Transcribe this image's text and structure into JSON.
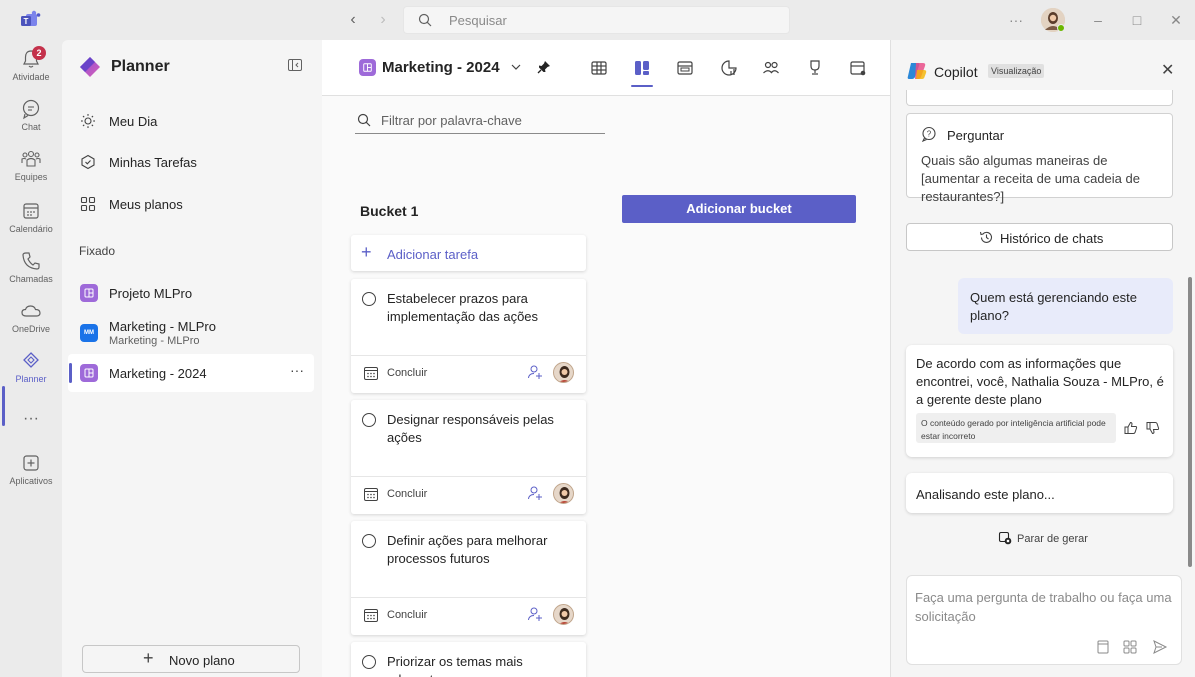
{
  "titlebar": {
    "search_placeholder": "Pesquisar",
    "more_label": "···"
  },
  "rail": {
    "badge_count": "2",
    "items": [
      {
        "label": "Atividade",
        "icon": "bell-icon"
      },
      {
        "label": "Chat",
        "icon": "chat-icon"
      },
      {
        "label": "Equipes",
        "icon": "teams-icon"
      },
      {
        "label": "Calendário",
        "icon": "calendar-icon"
      },
      {
        "label": "Chamadas",
        "icon": "phone-icon"
      },
      {
        "label": "OneDrive",
        "icon": "cloud-icon"
      },
      {
        "label": "Planner",
        "icon": "planner-icon"
      },
      {
        "label": "···",
        "icon": "more-icon"
      },
      {
        "label": "Aplicativos",
        "icon": "add-apps-icon"
      }
    ]
  },
  "left_panel": {
    "title": "Planner",
    "nav": [
      {
        "label": "Meu Dia",
        "icon": "sun-icon"
      },
      {
        "label": "Minhas Tarefas",
        "icon": "tasks-icon"
      },
      {
        "label": "Meus planos",
        "icon": "grid-icon"
      }
    ],
    "pinned_label": "Fixado",
    "plans": [
      {
        "name": "Projeto MLPro",
        "subtitle": ""
      },
      {
        "name": "Marketing - MLPro",
        "subtitle": "Marketing - MLPro",
        "icon_text": "MM"
      },
      {
        "name": "Marketing - 2024",
        "subtitle": "",
        "more": "···"
      }
    ],
    "new_plan_label": "Novo plano"
  },
  "main": {
    "plan_title": "Marketing - 2024",
    "filter_placeholder": "Filtrar por palavra-chave",
    "bucket_title": "Bucket 1",
    "add_bucket_label": "Adicionar bucket",
    "add_task_label": "Adicionar tarefa",
    "tasks": [
      {
        "title": "Estabelecer prazos para implementação das ações",
        "due": "Concluir"
      },
      {
        "title": "Designar responsáveis pelas ações",
        "due": "Concluir"
      },
      {
        "title": "Definir ações para melhorar processos futuros",
        "due": "Concluir"
      },
      {
        "title": "Priorizar os temas mais relevantes",
        "due": ""
      }
    ]
  },
  "copilot": {
    "title": "Copilot",
    "badge": "Visualização",
    "ask_title": "Perguntar",
    "ask_body": "Quais são algumas maneiras de [aumentar a receita de uma cadeia de restaurantes?]",
    "history_label": "Histórico de chats",
    "user_message": "Quem está gerenciando este plano?",
    "bot_message": "De acordo com as informações que encontrei, você, Nathalia Souza - MLPro, é a gerente deste plano",
    "ai_disclaimer": "O conteúdo gerado por inteligência artificial pode estar incorreto",
    "analyzing_label": "Analisando este plano...",
    "stop_label": "Parar de gerar",
    "composer_placeholder": "Faça uma pergunta de trabalho ou faça uma solicitação"
  },
  "colors": {
    "accent": "#5b5fc7",
    "plan_purple": "#9e6ad9",
    "badge_red": "#c4314b"
  }
}
